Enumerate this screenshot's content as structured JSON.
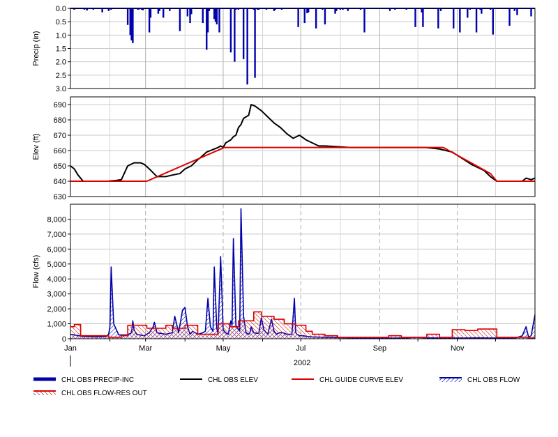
{
  "chart_data": [
    {
      "type": "bar",
      "ylabel": "Precip (in)",
      "ylim": [
        0.0,
        3.0
      ],
      "y_inverted": true,
      "yticks": [
        "0.0",
        "0.5",
        "1.0",
        "1.5",
        "2.0",
        "2.5",
        "3.0"
      ],
      "grid": true,
      "series": [
        {
          "name": "CHL OBS PRECIP-INC",
          "color": "#0000aa",
          "days": [
            3,
            11,
            13,
            18,
            25,
            30,
            32,
            45,
            47,
            48,
            49,
            53,
            54,
            56,
            57,
            62,
            63,
            69,
            70,
            73,
            78,
            86,
            92,
            94,
            95,
            104,
            107,
            108,
            109,
            113,
            114,
            115,
            117,
            126,
            129,
            130,
            132,
            136,
            139,
            144,
            145,
            147,
            148,
            154,
            160,
            161,
            166,
            179,
            184,
            186,
            187,
            193,
            198,
            200,
            208,
            209,
            212,
            214,
            218,
            228,
            231,
            251,
            255,
            264,
            271,
            277,
            276,
            289,
            291,
            301,
            306,
            312,
            314,
            319,
            322,
            323,
            330,
            332,
            345,
            349,
            351,
            362
          ],
          "values": [
            0.05,
            0.05,
            0.08,
            0.05,
            0.15,
            0.1,
            0.05,
            0.62,
            1.0,
            1.2,
            1.3,
            0.05,
            0.04,
            0.05,
            0.07,
            0.9,
            0.35,
            0.2,
            0.1,
            0.35,
            0.1,
            0.85,
            0.3,
            0.55,
            0.22,
            0.55,
            1.55,
            0.9,
            0.1,
            0.4,
            0.5,
            0.6,
            0.9,
            1.65,
            2.0,
            0.05,
            0.05,
            1.9,
            2.85,
            0.05,
            2.6,
            0.05,
            0.05,
            0.05,
            0.1,
            0.05,
            0.05,
            0.7,
            0.55,
            0.18,
            0.15,
            0.75,
            0.05,
            0.6,
            0.2,
            0.1,
            0.05,
            0.05,
            0.1,
            0.05,
            0.9,
            0.1,
            0.05,
            0.05,
            0.7,
            0.7,
            0.15,
            0.75,
            0.1,
            0.75,
            0.9,
            0.35,
            0.05,
            0.9,
            0.05,
            0.2,
            0.05,
            0.98,
            0.65,
            0.1,
            0.25,
            0.3
          ]
        }
      ]
    },
    {
      "type": "line",
      "ylabel": "Elev (ft)",
      "ylim": [
        630,
        695
      ],
      "yticks": [
        "630",
        "640",
        "650",
        "660",
        "670",
        "680",
        "690"
      ],
      "grid": true,
      "series": [
        {
          "name": "CHL OBS ELEV",
          "color": "#000000",
          "days": [
            0,
            3,
            6,
            10,
            16,
            22,
            29,
            36,
            40,
            45,
            50,
            55,
            58,
            62,
            68,
            75,
            80,
            86,
            90,
            95,
            100,
            103,
            107,
            110,
            113,
            116,
            118,
            120,
            122,
            126,
            128,
            130,
            132,
            134,
            136,
            138,
            140,
            142,
            145,
            150,
            155,
            160,
            165,
            170,
            175,
            180,
            185,
            190,
            195,
            200,
            220,
            250,
            265,
            279,
            290,
            300,
            315,
            325,
            330,
            335,
            340,
            345,
            350,
            355,
            358,
            362,
            365
          ],
          "values": [
            650,
            648,
            644,
            640,
            640,
            640,
            640,
            640.5,
            641,
            650,
            652,
            652,
            651,
            648,
            643,
            643,
            644,
            645,
            648,
            650,
            654,
            656,
            659,
            660,
            661,
            662,
            663,
            662,
            665,
            667,
            669,
            670,
            675,
            677,
            681,
            682,
            683,
            690,
            689,
            686,
            682,
            678,
            675,
            671,
            668,
            670,
            667,
            665,
            663,
            663,
            662,
            662,
            662,
            662,
            661,
            659,
            651,
            647,
            643,
            640,
            640,
            640,
            640,
            640,
            642,
            641,
            642
          ]
        },
        {
          "name": "CHL GUIDE CURVE ELEV",
          "color": "#dd0000",
          "days": [
            0,
            60,
            121,
            293,
            330,
            335,
            365
          ],
          "values": [
            640,
            640,
            662,
            662,
            645,
            640,
            640
          ]
        }
      ]
    },
    {
      "type": "line",
      "ylabel": "Flow (cfs)",
      "ylim": [
        0,
        9000
      ],
      "yticks": [
        "0",
        "1,000",
        "2,000",
        "3,000",
        "4,000",
        "5,000",
        "6,000",
        "7,000",
        "8,000"
      ],
      "xticks": [
        "Jan",
        "Mar",
        "May",
        "Jul",
        "Sep",
        "Nov"
      ],
      "xtick_days": [
        0,
        59,
        120,
        181,
        243,
        304
      ],
      "xlabel": "2002",
      "grid": true,
      "series": [
        {
          "name": "CHL OBS FLOW",
          "color": "#0000aa",
          "days": [
            0,
            10,
            20,
            28,
            30,
            31,
            32,
            34,
            38,
            45,
            48,
            49,
            50,
            52,
            58,
            62,
            65,
            66,
            68,
            75,
            80,
            82,
            85,
            88,
            90,
            92,
            94,
            96,
            100,
            104,
            106,
            108,
            110,
            112,
            113,
            115,
            116,
            118,
            120,
            122,
            124,
            126,
            127,
            128,
            130,
            133,
            134,
            136,
            138,
            140,
            141,
            142,
            144,
            148,
            150,
            152,
            155,
            158,
            160,
            162,
            164,
            167,
            170,
            174,
            176,
            177,
            178,
            180,
            183,
            186,
            190,
            200,
            210,
            220,
            240,
            255,
            265,
            270,
            280,
            290,
            300,
            310,
            320,
            330,
            340,
            350,
            355,
            358,
            360,
            362,
            365
          ],
          "values": [
            300,
            150,
            120,
            150,
            300,
            800,
            4800,
            1000,
            250,
            250,
            400,
            1200,
            600,
            300,
            200,
            400,
            800,
            1100,
            400,
            300,
            400,
            1500,
            400,
            1900,
            2100,
            800,
            300,
            500,
            300,
            400,
            500,
            2700,
            800,
            500,
            4800,
            700,
            300,
            5500,
            600,
            400,
            300,
            1200,
            900,
            6700,
            900,
            500,
            8700,
            1500,
            400,
            300,
            400,
            800,
            400,
            350,
            1400,
            600,
            300,
            1300,
            500,
            300,
            400,
            400,
            300,
            300,
            2700,
            400,
            300,
            200,
            200,
            150,
            120,
            100,
            80,
            60,
            50,
            40,
            60,
            100,
            60,
            50,
            50,
            50,
            60,
            50,
            50,
            60,
            200,
            800,
            100,
            200,
            1600
          ]
        },
        {
          "name": "CHL OBS FLOW-RES OUT",
          "color": "#dd0000",
          "days": [
            0,
            3,
            3,
            8,
            8,
            30,
            30,
            40,
            40,
            45,
            45,
            60,
            60,
            75,
            75,
            80,
            80,
            90,
            90,
            100,
            100,
            116,
            116,
            125,
            125,
            132,
            132,
            144,
            144,
            150,
            150,
            160,
            160,
            168,
            168,
            177,
            177,
            185,
            185,
            190,
            190,
            200,
            200,
            210,
            210,
            250,
            250,
            260,
            260,
            280,
            280,
            290,
            290,
            300,
            300,
            310,
            310,
            320,
            320,
            335,
            335,
            360,
            360,
            365
          ],
          "values": [
            800,
            800,
            950,
            950,
            200,
            200,
            100,
            100,
            200,
            200,
            900,
            900,
            700,
            700,
            900,
            900,
            700,
            700,
            900,
            900,
            300,
            300,
            1000,
            1000,
            800,
            800,
            1200,
            1200,
            1800,
            1800,
            1500,
            1500,
            1300,
            1300,
            1000,
            1000,
            900,
            900,
            500,
            500,
            300,
            300,
            200,
            200,
            100,
            100,
            200,
            200,
            100,
            100,
            300,
            300,
            100,
            100,
            600,
            600,
            550,
            550,
            650,
            650,
            100,
            100,
            50,
            50
          ]
        }
      ]
    }
  ],
  "legend": [
    {
      "label": "CHL OBS PRECIP-INC",
      "style": "thick",
      "color": "#0000aa"
    },
    {
      "label": "CHL OBS ELEV",
      "style": "line",
      "color": "#000000"
    },
    {
      "label": "CHL GUIDE CURVE ELEV",
      "style": "line",
      "color": "#dd0000"
    },
    {
      "label": "CHL OBS FLOW",
      "style": "hatch",
      "color": "#0000aa"
    },
    {
      "label": "CHL OBS FLOW-RES OUT",
      "style": "hatch",
      "color": "#dd0000"
    }
  ]
}
